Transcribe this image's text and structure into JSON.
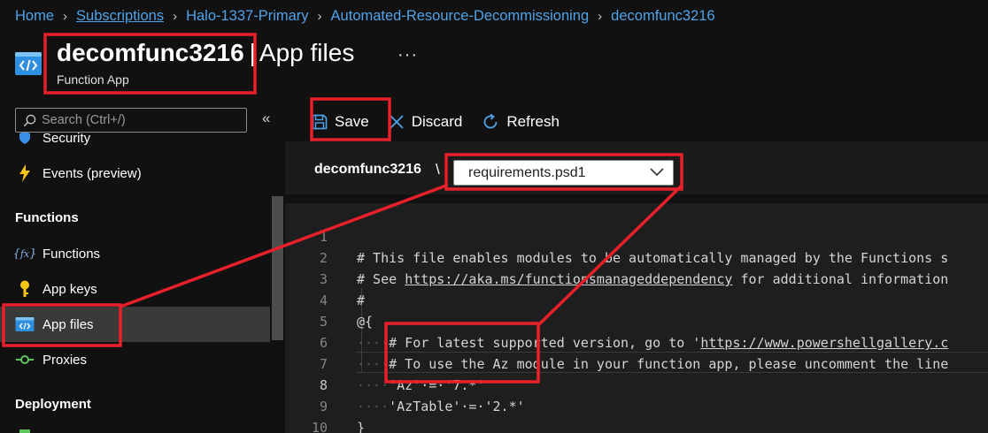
{
  "breadcrumb": [
    {
      "label": "Home",
      "underline": false
    },
    {
      "label": "Subscriptions",
      "underline": true
    },
    {
      "label": "Halo-1337-Primary",
      "underline": false
    },
    {
      "label": "Automated-Resource-Decommissioning",
      "underline": false
    },
    {
      "label": "decomfunc3216",
      "underline": false
    }
  ],
  "header": {
    "resource_name": "decomfunc3216",
    "divider": "|",
    "page_title": "App files",
    "subtitle": "Function App",
    "more": "···",
    "icon": "function-app-icon"
  },
  "sidebar": {
    "search_placeholder": "Search (Ctrl+/)",
    "collapse": "«",
    "partial_item": "Security",
    "events_item": "Events (preview)",
    "section_functions": "Functions",
    "items": [
      {
        "label": "Functions",
        "icon": "function-icon"
      },
      {
        "label": "App keys",
        "icon": "key-icon"
      },
      {
        "label": "App files",
        "icon": "app-files-icon",
        "active": true
      },
      {
        "label": "Proxies",
        "icon": "proxy-icon"
      }
    ],
    "section_deployment": "Deployment"
  },
  "toolbar": {
    "save_label": "Save",
    "discard_label": "Discard",
    "refresh_label": "Refresh"
  },
  "file_bar": {
    "root": "decomfunc3216",
    "separator": "\\",
    "selected_file": "requirements.psd1"
  },
  "editor": {
    "current_line": 8,
    "lines": [
      {
        "n": "1",
        "indent": "",
        "text": "# This file enables modules to be automatically managed by the Functions s"
      },
      {
        "n": "2",
        "indent": "",
        "pre": "# See ",
        "link": "https://aka.ms/functionsmanageddependency",
        "post": " for additional information"
      },
      {
        "n": "3",
        "indent": "",
        "text": "#"
      },
      {
        "n": "4",
        "indent": "",
        "text": "@{"
      },
      {
        "n": "5",
        "indent": "····",
        "pre": "# For latest supported version, go to '",
        "link": "https://www.powershellgallery.c",
        "post": ""
      },
      {
        "n": "6",
        "indent": "····",
        "text": "# To use the Az module in your function app, please uncomment the line"
      },
      {
        "n": "7",
        "indent": "····",
        "text": "'Az'·=·'7.*'"
      },
      {
        "n": "8",
        "indent": "····",
        "text": "'AzTable'·=·'2.*'"
      },
      {
        "n": "9",
        "indent": "",
        "text": "}"
      },
      {
        "n": "10",
        "indent": "",
        "text": ""
      }
    ]
  },
  "colors": {
    "background": "#111111",
    "link": "#4fa3ea",
    "highlight": "#e8202a",
    "editor_bg": "#1e1e1e"
  }
}
